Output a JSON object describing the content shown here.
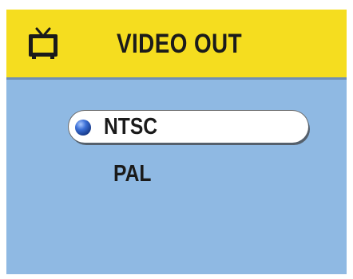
{
  "header": {
    "title": "VIDEO OUT",
    "icon": "tv-icon"
  },
  "options": [
    {
      "label": "NTSC",
      "selected": true
    },
    {
      "label": "PAL",
      "selected": false
    }
  ],
  "colors": {
    "header_background": "#f5dd1f",
    "screen_background": "#8fb9e3",
    "selection_background": "#ffffff",
    "text": "#1b1b1b"
  }
}
